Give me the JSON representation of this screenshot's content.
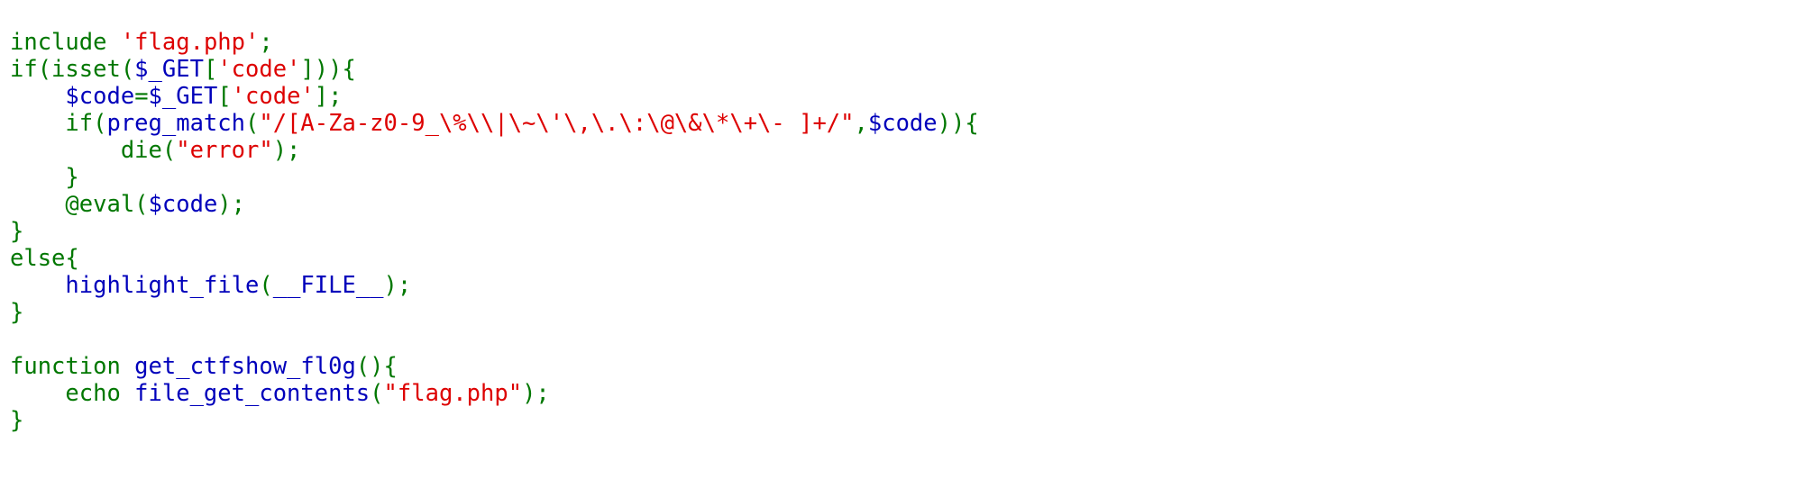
{
  "colors": {
    "background": "#FFFFFF",
    "keyword": "#007700",
    "string": "#DD0000",
    "default": "#0000BB"
  },
  "code": {
    "lines": [
      [
        {
          "t": "include ",
          "c": "kw"
        },
        {
          "t": "'flag.php'",
          "c": "str"
        },
        {
          "t": ";",
          "c": "pun"
        }
      ],
      [
        {
          "t": "if(isset(",
          "c": "kw"
        },
        {
          "t": "$_GET",
          "c": "var"
        },
        {
          "t": "[",
          "c": "pun"
        },
        {
          "t": "'code'",
          "c": "str"
        },
        {
          "t": "])){",
          "c": "pun"
        }
      ],
      [
        {
          "t": "    ",
          "c": "pun"
        },
        {
          "t": "$code",
          "c": "var"
        },
        {
          "t": "=",
          "c": "pun"
        },
        {
          "t": "$_GET",
          "c": "var"
        },
        {
          "t": "[",
          "c": "pun"
        },
        {
          "t": "'code'",
          "c": "str"
        },
        {
          "t": "];",
          "c": "pun"
        }
      ],
      [
        {
          "t": "    if(",
          "c": "kw"
        },
        {
          "t": "preg_match",
          "c": "fn"
        },
        {
          "t": "(",
          "c": "pun"
        },
        {
          "t": "\"/[A-Za-z0-9_\\%\\\\|\\~\\'\\,\\.\\:\\@\\&\\*\\+\\- ]+/\"",
          "c": "str"
        },
        {
          "t": ",",
          "c": "pun"
        },
        {
          "t": "$code",
          "c": "var"
        },
        {
          "t": ")){",
          "c": "pun"
        }
      ],
      [
        {
          "t": "        die(",
          "c": "kw"
        },
        {
          "t": "\"error\"",
          "c": "str"
        },
        {
          "t": ");",
          "c": "pun"
        }
      ],
      [
        {
          "t": "    }",
          "c": "pun"
        }
      ],
      [
        {
          "t": "    @eval(",
          "c": "kw"
        },
        {
          "t": "$code",
          "c": "var"
        },
        {
          "t": ");",
          "c": "pun"
        }
      ],
      [
        {
          "t": "}",
          "c": "pun"
        }
      ],
      [
        {
          "t": "else{",
          "c": "kw"
        }
      ],
      [
        {
          "t": "    ",
          "c": "pun"
        },
        {
          "t": "highlight_file",
          "c": "fn"
        },
        {
          "t": "(",
          "c": "pun"
        },
        {
          "t": "__FILE__",
          "c": "var"
        },
        {
          "t": ");",
          "c": "pun"
        }
      ],
      [
        {
          "t": "}",
          "c": "pun"
        }
      ],
      [],
      [
        {
          "t": "function ",
          "c": "kw"
        },
        {
          "t": "get_ctfshow_fl0g",
          "c": "fn"
        },
        {
          "t": "(){",
          "c": "pun"
        }
      ],
      [
        {
          "t": "    echo ",
          "c": "kw"
        },
        {
          "t": "file_get_contents",
          "c": "fn"
        },
        {
          "t": "(",
          "c": "pun"
        },
        {
          "t": "\"flag.php\"",
          "c": "str"
        },
        {
          "t": ");",
          "c": "pun"
        }
      ],
      [
        {
          "t": "}",
          "c": "pun"
        }
      ]
    ]
  }
}
